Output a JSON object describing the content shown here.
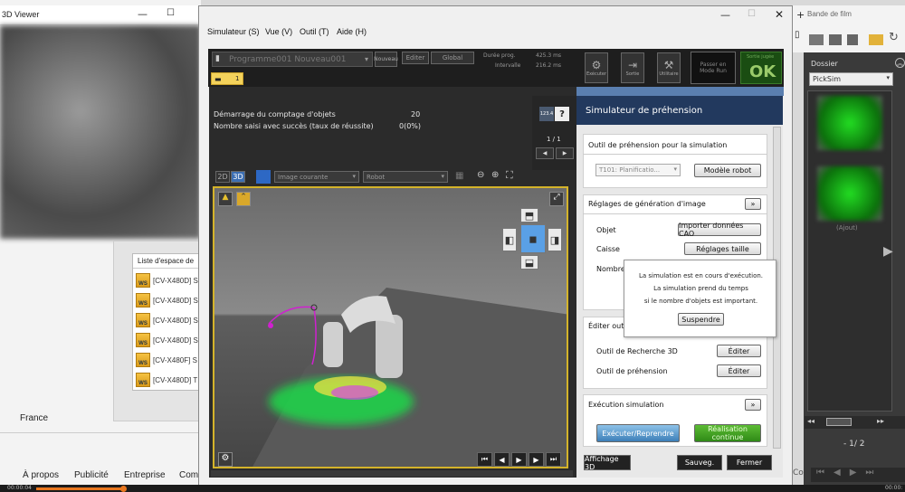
{
  "bg_window": {
    "title": "3D Viewer",
    "list_header": "Liste d'espace de",
    "items": [
      "[CV-X480D] S",
      "[CV-X480D] S",
      "[CV-X480D] S",
      "[CV-X480D] S",
      "[CV-X480F] S",
      "[CV-X480D] T"
    ],
    "country": "France",
    "footer": [
      "À propos",
      "Publicité",
      "Entreprise",
      "Com"
    ],
    "time_left": "00:00:04",
    "time_right": "00:00:"
  },
  "film": {
    "title": "Bande de film",
    "folder_label": "Dossier",
    "folder_value": "PickSim",
    "page": "-  1/  2",
    "thumb_caption": "(Ajout)",
    "cut_text": "Co"
  },
  "menu": [
    "Simulateur (S)",
    "Vue (V)",
    "Outil (T)",
    "Aide (H)"
  ],
  "toolbar": {
    "program": "Programme001  Nouveau001",
    "nouveau_btn": "Nouveau",
    "editer_btn": "Editer",
    "global_btn": "Global",
    "duree_label": "Durée prog.",
    "duree_value": "425.3 ms",
    "intervalle_label": "Intervalle",
    "intervalle_value": "216.2 ms",
    "executer": "Exécuter",
    "sortie": "Sortie",
    "utilitaire": "Utilitaire",
    "passer": "Passer en\nMode Run",
    "ok_label": "Sortie jugée",
    "ok": "OK",
    "tab_num": "1"
  },
  "stats": {
    "line1_label": "Démarrage du comptage d'objets",
    "line1_value": "20",
    "line2_label": "Nombre saisi avec succès (taux de réussite)",
    "line2_value": "0(0%)",
    "pager": "1 / 1",
    "icon_label": "123.4"
  },
  "viewer": {
    "mode2d": "2D",
    "mode3d": "3D",
    "image_select": "Image courante",
    "robot_select": "Robot"
  },
  "panel": {
    "title": "Simulateur de préhension",
    "s1_title": "Outil de préhension pour la simulation",
    "tool_select": "T101: Planificatio...",
    "modele_btn": "Modèle robot",
    "s2_title": "Réglages de génération d'image",
    "objet": "Objet",
    "importer_btn": "Importer données CAO",
    "caisse": "Caisse",
    "reglages_btn": "Réglages taille",
    "nombre": "Nombre",
    "popup_l1": "La simulation est en cours d'exécution.",
    "popup_l2": "La simulation prend du temps",
    "popup_l3": "si le nombre d'objets est important.",
    "suspendre_btn": "Suspendre",
    "s3_title": "Éditer outil",
    "outil3d": "Outil de Recherche 3D",
    "outilp": "Outil de préhension",
    "editer": "Éditer",
    "s4_title": "Exécution simulation",
    "exec_btn": "Exécuter/Reprendre",
    "real_btn": "Réalisation\ncontinue",
    "affichage_btn": "Affichage 3D",
    "sauveg_btn": "Sauveg.",
    "fermer_btn": "Fermer",
    "expand": "»"
  }
}
